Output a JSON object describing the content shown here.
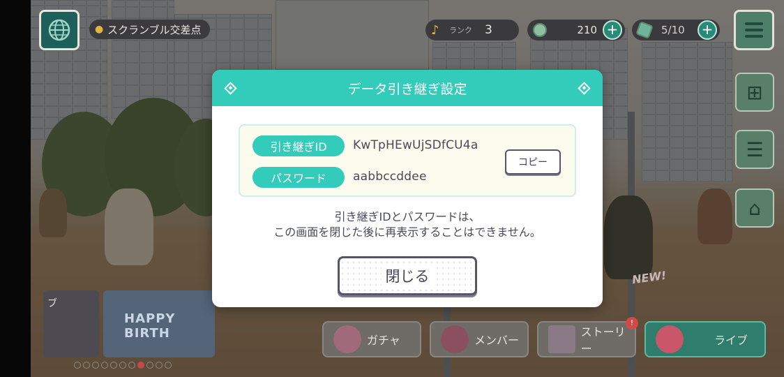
{
  "hud": {
    "location": "スクランブル交差点",
    "rank_label": "ランク",
    "rank_value": "3",
    "coins": "210",
    "stamina": "5/10"
  },
  "bottom_nav": {
    "gacha": "ガチャ",
    "member": "メンバー",
    "story": "ストーリー",
    "story_badge": "!",
    "live": "ライブ"
  },
  "banners": {
    "left_text": "ブ",
    "right_text": "HAPPY BIRTH"
  },
  "new_tag": "NEW!",
  "dialog": {
    "title": "データ引き継ぎ設定",
    "id_label": "引き継ぎID",
    "id_value": "KwTpHEwUjSDfCU4a",
    "password_label": "パスワード",
    "password_value": "aabbccddee",
    "copy_label": "コピー",
    "note_line1": "引き継ぎIDとパスワードは、",
    "note_line2": "この画面を閉じた後に再表示することはできません。",
    "close_label": "閉じる"
  },
  "colors": {
    "accent": "#33ccbb",
    "info_box_bg": "#fbfbee",
    "button_border": "#555468",
    "text": "#4a4a5a"
  },
  "icons": [
    "globe-icon",
    "map-pin-icon",
    "music-note-icon",
    "gem-icon",
    "plus-icon",
    "menu-icon",
    "gift-icon",
    "list-icon",
    "shop-icon",
    "diamond-icon"
  ]
}
